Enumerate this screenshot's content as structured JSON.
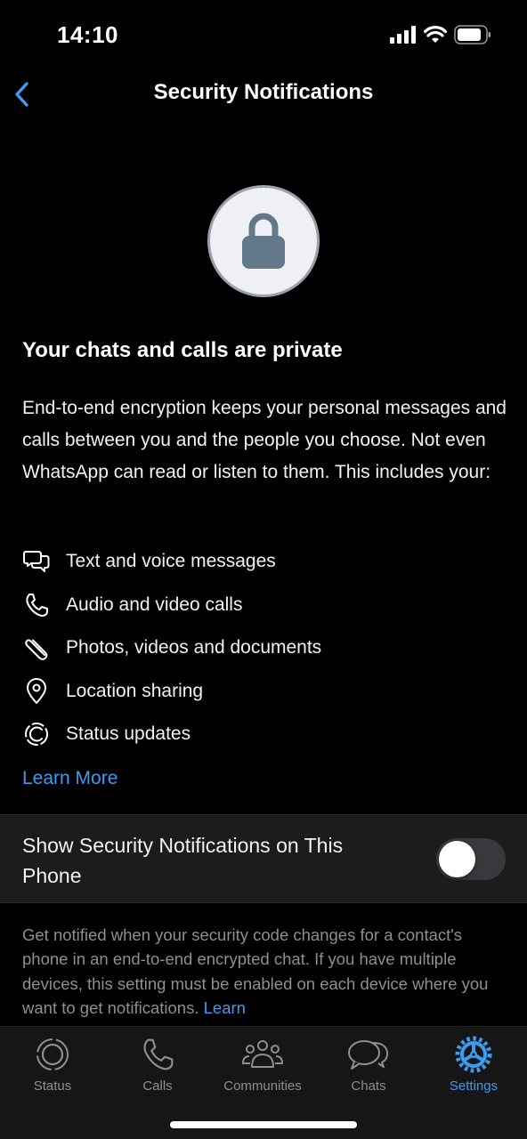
{
  "status_bar": {
    "time": "14:10",
    "icons": [
      "signal-icon",
      "wifi-icon",
      "battery-icon"
    ]
  },
  "nav": {
    "title": "Security Notifications",
    "back_icon": "chevron-left-icon"
  },
  "hero": {
    "icon": "lock-icon"
  },
  "heading": "Your chats and calls are private",
  "body": "End-to-end encryption keeps your personal messages and calls between you and the people you choose. Not even WhatsApp can read or listen to them. This includes your:",
  "features": [
    {
      "icon": "chat-bubbles-icon",
      "label": "Text and voice messages"
    },
    {
      "icon": "phone-icon",
      "label": "Audio and video calls"
    },
    {
      "icon": "paperclip-icon",
      "label": "Photos, videos and documents"
    },
    {
      "icon": "location-pin-icon",
      "label": "Location sharing"
    },
    {
      "icon": "status-icon",
      "label": "Status updates"
    }
  ],
  "learn_more": "Learn More",
  "toggle": {
    "label": "Show Security Notifications on This Phone",
    "enabled": false
  },
  "footer": {
    "text": "Get notified when your security code changes for a contact's phone in an end-to-end encrypted chat. If you have multiple devices, this setting must be enabled on each device where you want to get notifications.",
    "link": "Learn"
  },
  "tabbar": {
    "tabs": [
      {
        "label": "Status",
        "icon": "status-icon",
        "active": false
      },
      {
        "label": "Calls",
        "icon": "phone-icon",
        "active": false
      },
      {
        "label": "Communities",
        "icon": "communities-icon",
        "active": false
      },
      {
        "label": "Chats",
        "icon": "chats-icon",
        "active": false
      },
      {
        "label": "Settings",
        "icon": "settings-gear-icon",
        "active": true
      }
    ]
  },
  "colors": {
    "accent": "#3d9cf0",
    "background": "#000000",
    "row_bg": "#1c1c1e",
    "secondary_text": "#8e8e93",
    "lock": "#63798a"
  }
}
